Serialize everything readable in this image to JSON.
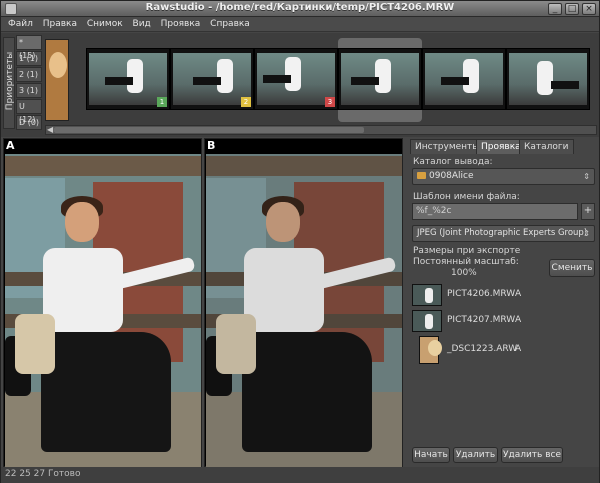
{
  "window": {
    "title": "Rawstudio - /home/red/Картинки/temp/PICT4206.MRW",
    "min_label": "_",
    "max_label": "□",
    "close_label": "×"
  },
  "menu": [
    "Файл",
    "Правка",
    "Снимок",
    "Вид",
    "Проявка",
    "Справка"
  ],
  "priorities": {
    "label": "Приоритеты",
    "items": [
      "* (15)",
      "1 (1)",
      "2 (1)",
      "3 (1)",
      "U (12)",
      "D (0)"
    ]
  },
  "thumb_badges": [
    "1",
    "2",
    "3"
  ],
  "badge_colors": {
    "one": "#5aa85a",
    "two": "#e0c040",
    "three": "#d04848"
  },
  "scroll": {
    "left_arrow": "◀"
  },
  "preview": {
    "a_label": "A",
    "b_label": "B"
  },
  "panel": {
    "tabs": [
      "Инструменты",
      "Проявка",
      "Каталоги"
    ],
    "output_dir_label": "Каталог вывода:",
    "output_dir_value": "0908Alice",
    "filename_template_label": "Шаблон имени файла:",
    "filename_template_value": "%f_%2c",
    "plus_label": "+",
    "format_value": "JPEG (Joint Photographic Experts Group)",
    "export_size_label": "Размеры при экспорте",
    "scale_label": "Постоянный масштаб:",
    "scale_value": "100%",
    "change_button": "Сменить",
    "queue": [
      {
        "name": "PICT4206.MRW",
        "priority": "A"
      },
      {
        "name": "PICT4207.MRW",
        "priority": "A"
      },
      {
        "name": "_DSC1223.ARW",
        "priority": "A"
      }
    ],
    "start_button": "Начать",
    "remove_button": "Удалить",
    "remove_all_button": "Удалить все"
  },
  "status": {
    "text": "22 25 27 Готово"
  }
}
